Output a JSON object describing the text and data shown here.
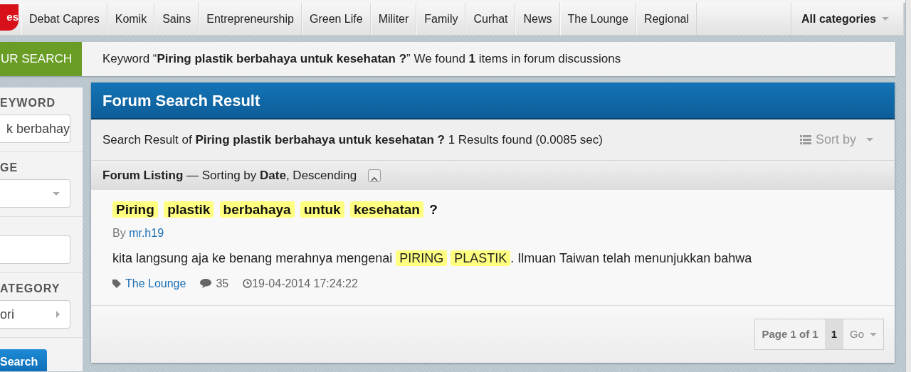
{
  "logo": {
    "text": "es"
  },
  "nav": {
    "items": [
      {
        "label": "Debat Capres",
        "kind": "link"
      },
      {
        "label": "Komik",
        "kind": "link"
      },
      {
        "label": "Sains",
        "kind": "link"
      },
      {
        "label": "Entrepreneurship",
        "kind": "link"
      },
      {
        "label": "Green Life",
        "kind": "link"
      },
      {
        "label": "Militer",
        "kind": "link"
      },
      {
        "label": "Family",
        "kind": "link"
      },
      {
        "label": "Curhat",
        "kind": "link"
      },
      {
        "label": "News",
        "kind": "link"
      },
      {
        "label": "The Lounge",
        "kind": "link"
      },
      {
        "label": "Regional",
        "kind": "link"
      },
      {
        "label": "All categories",
        "kind": "dropdown"
      }
    ]
  },
  "search_banner": {
    "tab": "UR SEARCH",
    "message": "Keyword “**Piring plastik berbahaya untuk kesehatan ?**” We found **1** items in forum discussions"
  },
  "sidebar": {
    "fields": [
      {
        "label": "EYWORD",
        "kind": "text",
        "value": "k berbahay"
      },
      {
        "label": "GE",
        "kind": "select"
      },
      {
        "kind": "text"
      },
      {
        "label": "ATEGORY",
        "kind": "picker",
        "value": "ori"
      }
    ],
    "button": "Search"
  },
  "panel": {
    "title": "Forum Search Result",
    "summary": "Search Result of **Piring plastik berbahaya untuk kesehatan ?** 1 Results found (0.0085 sec)",
    "sort_button": "Sort by",
    "listing": "**Forum Listing** — Sorting by **Date**, Descending",
    "results": [
      {
        "title_parts": [
          {
            "text": "Piring",
            "highlight": true
          },
          {
            "text": "plastik",
            "highlight": true
          },
          {
            "text": "berbahaya",
            "highlight": true
          },
          {
            "text": "untuk",
            "highlight": true
          },
          {
            "text": "kesehatan",
            "highlight": true
          },
          {
            "text": "?",
            "highlight": false
          }
        ],
        "by": "By",
        "author": "mr.h19",
        "snippet_parts": [
          {
            "text": "kita langsung aja ke benang merahnya mengenai ",
            "highlight": false
          },
          {
            "text": "PIRING",
            "highlight": true
          },
          {
            "text": "PLASTIK",
            "highlight": true
          },
          {
            "text": ". Ilmuan Taiwan telah menunjukkan bahwa",
            "highlight": false
          }
        ],
        "category": "The Lounge",
        "replies": "35",
        "date": "19-04-2014 17:24:22"
      }
    ],
    "pagination": {
      "label": "Page 1 of 1",
      "pages": [
        {
          "label": "1",
          "selected": true
        }
      ],
      "go": "Go"
    }
  }
}
